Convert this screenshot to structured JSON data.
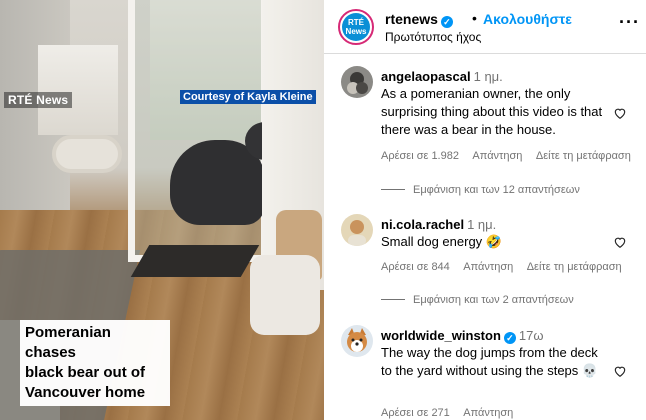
{
  "video": {
    "logo": "RTÉ News",
    "courtesy": "Courtesy of Kayla Kleine",
    "caption_lines": [
      "Pomeranian chases",
      "black bear out of",
      "Vancouver home"
    ]
  },
  "header": {
    "username": "rtenews",
    "separator": "•",
    "follow_label": "Ακολουθήστε",
    "audio": "Πρωτότυπος ήχος",
    "avatar_text_1": "RTÉ",
    "avatar_text_2": "News"
  },
  "comments": [
    {
      "username": "angelaopascal",
      "time": "1 ημ.",
      "text": "As a pomeranian owner, the only surprising thing about this video is that there was a bear in the house.",
      "likes": "Αρέσει σε 1.982",
      "reply": "Απάντηση",
      "translate": "Δείτε τη μετάφραση",
      "replies": "Εμφάνιση και των 12 απαντήσεων"
    },
    {
      "username": "ni.cola.rachel",
      "time": "1 ημ.",
      "text": "Small dog energy 🤣",
      "likes": "Αρέσει σε 844",
      "reply": "Απάντηση",
      "translate": "Δείτε τη μετάφραση",
      "replies": "Εμφάνιση και των 2 απαντήσεων"
    },
    {
      "username": "worldwide_winston",
      "time": "17ω",
      "text": "The way the dog jumps from the deck to the yard without using the steps 💀",
      "likes": "Αρέσει σε 271",
      "reply": "Απάντηση"
    }
  ],
  "colors": {
    "accent": "#0095f6",
    "muted": "#737373",
    "courtesy_bg": "#0b4fa8"
  }
}
